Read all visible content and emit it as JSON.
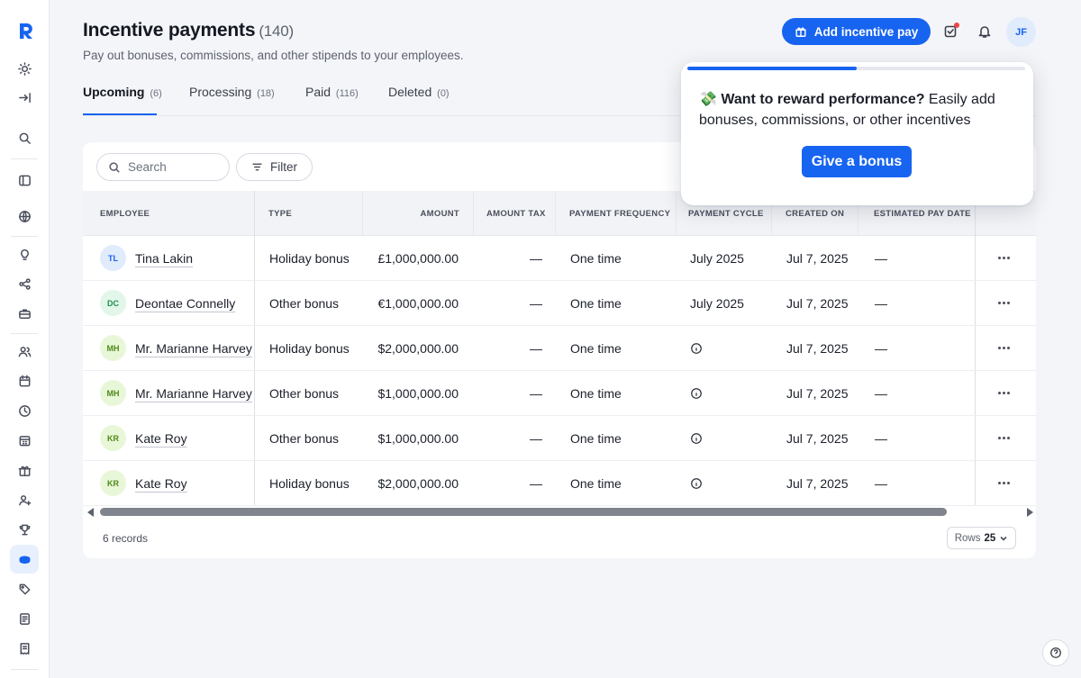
{
  "header": {
    "title": "Incentive payments",
    "count": "(140)",
    "subtitle": "Pay out bonuses, commissions, and other stipends to your employees.",
    "add_button": "Add incentive pay",
    "user_initials": "JF"
  },
  "tabs": [
    {
      "label": "Upcoming",
      "count": "(6)",
      "active": true
    },
    {
      "label": "Processing",
      "count": "(18)",
      "active": false
    },
    {
      "label": "Paid",
      "count": "(116)",
      "active": false
    },
    {
      "label": "Deleted",
      "count": "(0)",
      "active": false
    }
  ],
  "toolbar": {
    "search_placeholder": "Search",
    "filter_label": "Filter"
  },
  "table": {
    "columns": [
      "Employee",
      "Type",
      "Amount",
      "Amount tax",
      "Payment frequency",
      "Payment cycle",
      "Created on",
      "Estimated pay date"
    ],
    "rows": [
      {
        "initials": "TL",
        "avatar_bg": "#e0ebfc",
        "avatar_fg": "#1764f0",
        "employee": "Tina Lakin",
        "type": "Holiday bonus",
        "amount": "£1,000,000.00",
        "tax": "—",
        "frequency": "One time",
        "cycle": "July 2025",
        "cycle_icon": null,
        "created": "Jul 7, 2025",
        "pay_date": "—"
      },
      {
        "initials": "DC",
        "avatar_bg": "#e2f6ea",
        "avatar_fg": "#1f8f4e",
        "employee": "Deontae Connelly",
        "type": "Other bonus",
        "amount": "€1,000,000.00",
        "tax": "—",
        "frequency": "One time",
        "cycle": "July 2025",
        "cycle_icon": null,
        "created": "Jul 7, 2025",
        "pay_date": "—"
      },
      {
        "initials": "MH",
        "avatar_bg": "#e9f7d9",
        "avatar_fg": "#4d8a17",
        "employee": "Mr. Marianne Harvey",
        "type": "Holiday bonus",
        "amount": "$2,000,000.00",
        "tax": "—",
        "frequency": "One time",
        "cycle": "",
        "cycle_icon": "info-icon",
        "created": "Jul 7, 2025",
        "pay_date": "—"
      },
      {
        "initials": "MH",
        "avatar_bg": "#e9f7d9",
        "avatar_fg": "#4d8a17",
        "employee": "Mr. Marianne Harvey",
        "type": "Other bonus",
        "amount": "$1,000,000.00",
        "tax": "—",
        "frequency": "One time",
        "cycle": "",
        "cycle_icon": "info-icon",
        "created": "Jul 7, 2025",
        "pay_date": "—"
      },
      {
        "initials": "KR",
        "avatar_bg": "#e9f7d9",
        "avatar_fg": "#4d8a17",
        "employee": "Kate Roy",
        "type": "Other bonus",
        "amount": "$1,000,000.00",
        "tax": "—",
        "frequency": "One time",
        "cycle": "",
        "cycle_icon": "info-icon",
        "created": "Jul 7, 2025",
        "pay_date": "—"
      },
      {
        "initials": "KR",
        "avatar_bg": "#e9f7d9",
        "avatar_fg": "#4d8a17",
        "employee": "Kate Roy",
        "type": "Holiday bonus",
        "amount": "$2,000,000.00",
        "tax": "—",
        "frequency": "One time",
        "cycle": "",
        "cycle_icon": "info-icon",
        "created": "Jul 7, 2025",
        "pay_date": "—"
      }
    ]
  },
  "footer": {
    "records": "6 records",
    "rows_label": "Rows",
    "rows_value": "25"
  },
  "popover": {
    "emoji": "💸",
    "bold_text": "Want to reward performance?",
    "text": " Easily add bonuses, commissions, or other incentives",
    "button": "Give a bonus",
    "progress": 0.5
  },
  "colors": {
    "accent": "#1764f0",
    "background": "#f4f5f8"
  },
  "sidebar_icons": [
    "logo",
    "sun-icon",
    "collapse-icon",
    "search-icon",
    "panel-icon",
    "globe-icon",
    "lightbulb-icon",
    "share-icon",
    "briefcase-icon",
    "people-icon",
    "calendar-icon",
    "clock-icon",
    "calendar-grid-icon",
    "gift-icon",
    "add-person-icon",
    "trophy-icon",
    "coins-icon",
    "tag-icon",
    "document-icon",
    "receipt-icon"
  ]
}
